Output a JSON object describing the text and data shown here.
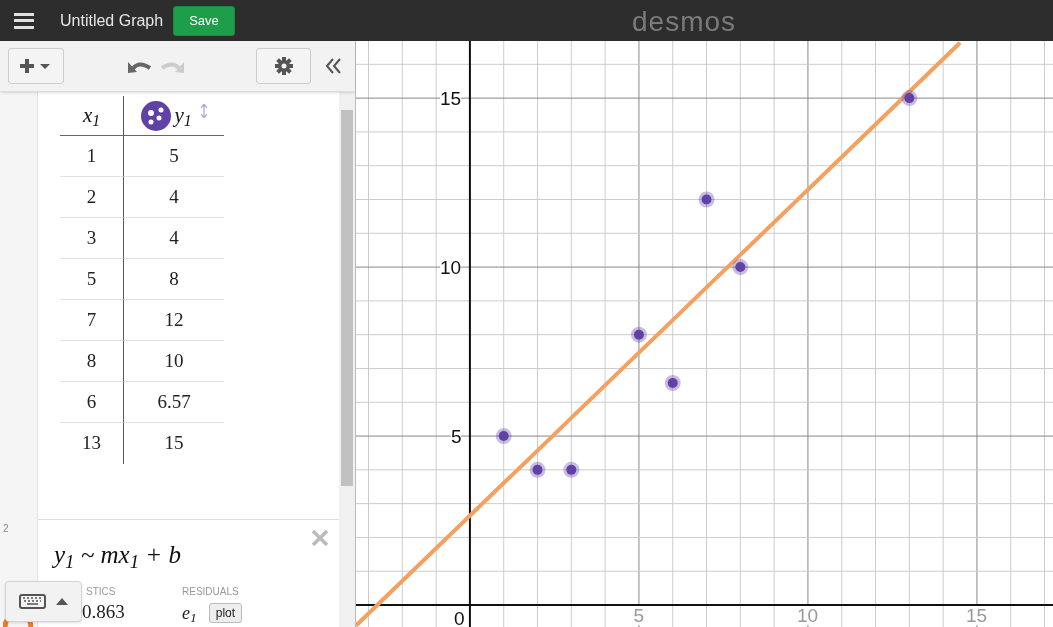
{
  "header": {
    "title": "Untitled Graph",
    "save": "Save",
    "logo": "desmos"
  },
  "table": {
    "columns": [
      {
        "label": "x$_{1}$"
      },
      {
        "label": "y$_{1}$",
        "color": "#6042a6"
      }
    ],
    "rows": [
      [
        "1",
        "5"
      ],
      [
        "2",
        "4"
      ],
      [
        "3",
        "4"
      ],
      [
        "5",
        "8"
      ],
      [
        "7",
        "12"
      ],
      [
        "8",
        "10"
      ],
      [
        "6",
        "6.57"
      ],
      [
        "13",
        "15"
      ]
    ]
  },
  "regression": {
    "number": "2",
    "formula": "y$_{1}$ ~ mx$_{1}$ + b",
    "statistics_label": "STICS",
    "statistics_value": "0.863",
    "residuals_label": "RESIDUALS",
    "residual": "e$_{1}$",
    "plot": "plot"
  },
  "graph": {
    "chart_data": {
      "type": "scatter",
      "x": [
        -3.37,
        1,
        2,
        3,
        5,
        6,
        7,
        8,
        13,
        14.5
      ],
      "series": [
        {
          "color": "#6042a6",
          "values": [
            null,
            5,
            4,
            4,
            8,
            6.57,
            12,
            10,
            15,
            null
          ]
        },
        {
          "type": "line",
          "color": "#f5a05e",
          "values": [
            -0.61,
            3.61,
            4.57,
            5.54,
            7.47,
            8.43,
            9.4,
            10.36,
            15.19,
            16.64
          ]
        }
      ],
      "grid": true,
      "xlim": [
        -3.37,
        17.25
      ],
      "ylim": [
        -0.65,
        16.69
      ],
      "xticks": [
        0,
        5,
        10,
        15
      ],
      "yticks": [
        5,
        10,
        15
      ]
    }
  }
}
